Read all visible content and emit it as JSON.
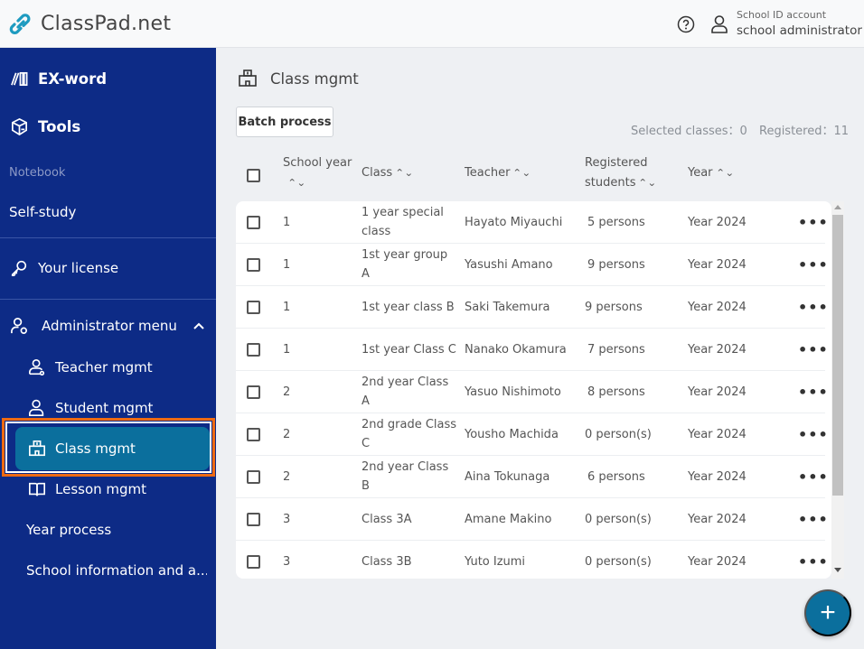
{
  "header": {
    "app_name": "ClassPad.net",
    "help_icon": "question-circle-icon",
    "user_icon": "user-icon",
    "account_type": "School ID account",
    "account_name": "school administrator"
  },
  "sidebar": {
    "items": [
      {
        "label": "EX-word",
        "icon": "dictionary-books-icon"
      },
      {
        "label": "Tools",
        "icon": "toolbox-icon"
      },
      {
        "label": "Notebook"
      },
      {
        "label": "Self-study"
      },
      {
        "label": "Your license",
        "icon": "key-icon"
      },
      {
        "label": "Administrator menu",
        "icon": "admin-user-gear-icon",
        "expanded": true
      },
      {
        "label": "Teacher mgmt",
        "icon": "teacher-icon"
      },
      {
        "label": "Student mgmt",
        "icon": "student-icon"
      },
      {
        "label": "Class mgmt",
        "icon": "school-building-icon",
        "active": true
      },
      {
        "label": "Lesson mgmt",
        "icon": "open-book-icon"
      },
      {
        "label": "Year process"
      },
      {
        "label": "School information and a..."
      }
    ]
  },
  "main": {
    "title": "Class mgmt",
    "title_icon": "school-building-icon",
    "batch_button": "Batch process",
    "selected_label": "Selected classes：0",
    "registered_label": "Registered：11",
    "columns": [
      {
        "line1": "School year",
        "line2": ""
      },
      {
        "line1": "Class"
      },
      {
        "line1": "Teacher"
      },
      {
        "line1": "Registered",
        "line2": "students"
      },
      {
        "line1": "Year"
      }
    ],
    "sort_glyph": "⌃⌄",
    "more_glyph": "•••",
    "rows": [
      {
        "year": "1",
        "class1": "1 year special",
        "class2": "class",
        "teacher": "Hayato Miyauchi",
        "students": "5 persons",
        "period": "Year 2024"
      },
      {
        "year": "1",
        "class1": "1st year group",
        "class2": "A",
        "teacher": "Yasushi Amano",
        "students": "9 persons",
        "period": "Year 2024"
      },
      {
        "year": "1",
        "class1": "1st year class B",
        "class2": "",
        "teacher": "Saki Takemura",
        "students": "9 persons",
        "period": "Year 2024"
      },
      {
        "year": "1",
        "class1": "1st year Class C",
        "class2": "",
        "teacher": "Nanako Okamura",
        "students": "7 persons",
        "period": "Year 2024"
      },
      {
        "year": "2",
        "class1": "2nd year Class",
        "class2": "A",
        "teacher": "Yasuo Nishimoto",
        "students": "8 persons",
        "period": "Year 2024"
      },
      {
        "year": "2",
        "class1": "2nd grade Class",
        "class2": "C",
        "teacher": "Yousho Machida",
        "students": "0 person(s)",
        "period": "Year 2024"
      },
      {
        "year": "2",
        "class1": "2nd year Class",
        "class2": "B",
        "teacher": "Aina Tokunaga",
        "students": "6 persons",
        "period": "Year 2024"
      },
      {
        "year": "3",
        "class1": "Class 3A",
        "class2": "",
        "teacher": "Amane Makino",
        "students": "0 person(s)",
        "period": "Year 2024"
      },
      {
        "year": "3",
        "class1": "Class 3B",
        "class2": "",
        "teacher": "Yuto Izumi",
        "students": "0 person(s)",
        "period": "Year 2024"
      }
    ],
    "add_button": "+"
  },
  "colors": {
    "sidebar_bg": "#0d2b86",
    "accent": "#0b6f9d",
    "highlight": "#ee6a12",
    "logo": "#1e9bc0"
  }
}
